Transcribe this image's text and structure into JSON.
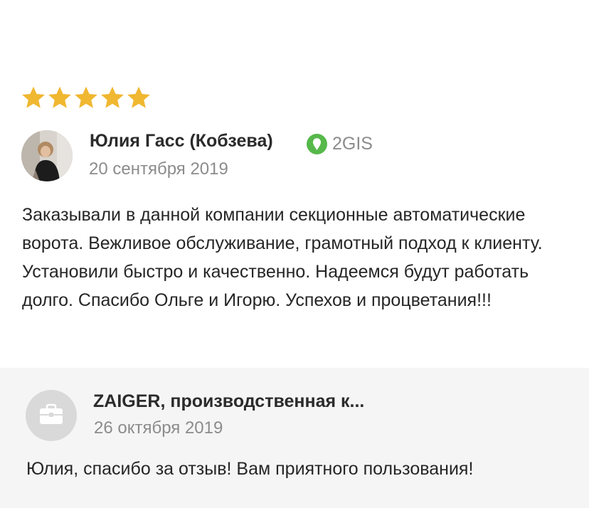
{
  "review": {
    "rating": 5,
    "rating_max": 5,
    "star_color": "#f0b731",
    "author": "Юлия Гасс (Кобзева)",
    "source": "2GIS",
    "source_icon": "2gis-pin-icon",
    "source_color": "#56b84a",
    "date": "20 сентября 2019",
    "text": "Заказывали в данной компании секционные автоматические ворота. Вежливое обслуживание, грамотный подход к клиенту. Установили быстро и качественно. Надеемся будут работать долго. Спасибо Ольге и Игорю. Успехов и процветания!!!"
  },
  "reply": {
    "author": "ZAIGER, производственная к...",
    "avatar_icon": "briefcase-icon",
    "date": "26 октября 2019",
    "text": "Юлия, спасибо за отзыв! Вам приятного пользования!"
  }
}
